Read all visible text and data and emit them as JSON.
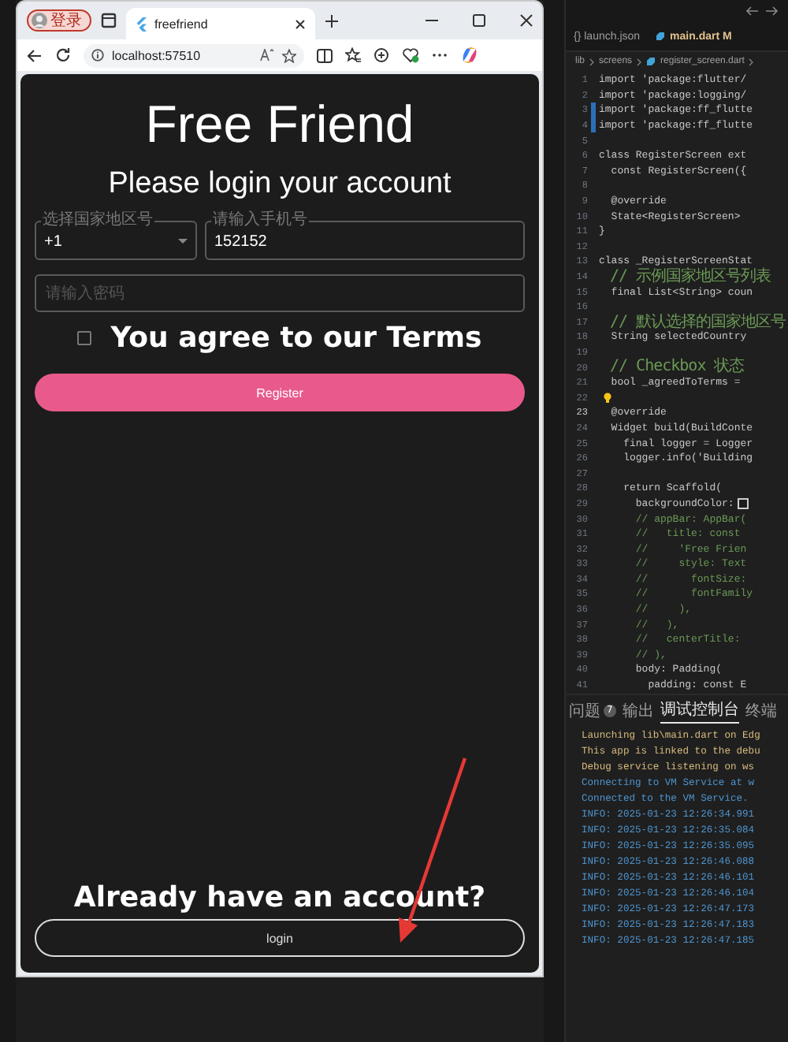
{
  "browser": {
    "profile_button": "登录",
    "tab": {
      "title": "freefriend"
    },
    "address": "localhost:57510"
  },
  "page": {
    "title": "Free Friend",
    "subtitle": "Please login your account",
    "country_field": {
      "label": "选择国家地区号",
      "value": "+1"
    },
    "phone_field": {
      "label": "请输入手机号",
      "value": "152152"
    },
    "password_field": {
      "placeholder": "请输入密码"
    },
    "terms": {
      "label": "You agree to our Terms",
      "checked": false
    },
    "register_button": "Register",
    "login_prompt": "Already have an account?",
    "login_button": "login"
  },
  "editor": {
    "tabs": [
      {
        "label": "{} launch.json",
        "modified": false
      },
      {
        "label": "main.dart",
        "badge": "M",
        "modified": true
      }
    ],
    "breadcrumb": [
      "lib",
      "screens",
      "register_screen.dart"
    ],
    "lines": [
      {
        "number": "1",
        "code": "import 'package:flutter/",
        "kind": "code",
        "current": false,
        "lightbulb": false,
        "changed": false
      },
      {
        "number": "2",
        "code": "import 'package:logging/",
        "kind": "code",
        "current": false,
        "lightbulb": false,
        "changed": false
      },
      {
        "number": "3",
        "code": "import 'package:ff_flutte",
        "kind": "code",
        "current": false,
        "lightbulb": false,
        "changed": true
      },
      {
        "number": "4",
        "code": "import 'package:ff_flutte",
        "kind": "code",
        "current": false,
        "lightbulb": false,
        "changed": true
      },
      {
        "number": "5",
        "current": false,
        "lightbulb": false,
        "changed": false
      },
      {
        "number": "6",
        "code": "class RegisterScreen ext",
        "kind": "code",
        "current": false,
        "lightbulb": false,
        "changed": false
      },
      {
        "number": "7",
        "code": "  const RegisterScreen({",
        "kind": "code",
        "current": false,
        "lightbulb": false,
        "changed": false
      },
      {
        "number": "8",
        "current": false,
        "lightbulb": false,
        "changed": false
      },
      {
        "number": "9",
        "code": "  @override",
        "kind": "code",
        "current": false,
        "lightbulb": false,
        "changed": false
      },
      {
        "number": "10",
        "code": "  State<RegisterScreen>",
        "kind": "code",
        "current": false,
        "lightbulb": false,
        "changed": false
      },
      {
        "number": "11",
        "code": "}",
        "kind": "code",
        "current": false,
        "lightbulb": false,
        "changed": false
      },
      {
        "number": "12",
        "current": false,
        "lightbulb": false,
        "changed": false
      },
      {
        "number": "13",
        "code": "class _RegisterScreenStat",
        "kind": "code",
        "current": false,
        "lightbulb": false,
        "changed": false
      },
      {
        "number": "14",
        "code": "// 示例国家地区号列表",
        "kind": "note",
        "current": false,
        "lightbulb": false,
        "changed": false
      },
      {
        "number": "15",
        "code": "  final List<String> coun",
        "kind": "code",
        "current": false,
        "lightbulb": false,
        "changed": false
      },
      {
        "number": "16",
        "current": false,
        "lightbulb": false,
        "changed": false
      },
      {
        "number": "17",
        "code": "// 默认选择的国家地区号",
        "kind": "note",
        "current": false,
        "lightbulb": false,
        "changed": false
      },
      {
        "number": "18",
        "code": "  String selectedCountry",
        "kind": "code",
        "current": false,
        "lightbulb": false,
        "changed": false
      },
      {
        "number": "19",
        "current": false,
        "lightbulb": false,
        "changed": false
      },
      {
        "number": "20",
        "code": "// Checkbox 状态",
        "kind": "note",
        "current": false,
        "lightbulb": false,
        "changed": false
      },
      {
        "number": "21",
        "code": "  bool _agreedToTerms =",
        "kind": "code",
        "current": false,
        "lightbulb": false,
        "changed": false
      },
      {
        "number": "22",
        "current": false,
        "lightbulb": true,
        "changed": false
      },
      {
        "number": "23",
        "code": "  @override",
        "kind": "code",
        "current": true,
        "lightbulb": false,
        "changed": false
      },
      {
        "number": "24",
        "code": "  Widget build(BuildConte",
        "kind": "code",
        "current": false,
        "lightbulb": false,
        "changed": false
      },
      {
        "number": "25",
        "code": "    final logger = Logger",
        "kind": "code",
        "current": false,
        "lightbulb": false,
        "changed": false
      },
      {
        "number": "26",
        "code": "    logger.info('Building",
        "kind": "code",
        "current": false,
        "lightbulb": false,
        "changed": false
      },
      {
        "number": "27",
        "current": false,
        "lightbulb": false,
        "changed": false
      },
      {
        "number": "28",
        "code": "    return Scaffold(",
        "kind": "code",
        "current": false,
        "lightbulb": false,
        "changed": false
      },
      {
        "number": "29",
        "code": "      backgroundColor:",
        "kind": "swatch",
        "current": false,
        "lightbulb": false,
        "changed": false
      },
      {
        "number": "30",
        "code": "      // appBar: AppBar(",
        "kind": "comment",
        "current": false,
        "lightbulb": false,
        "changed": false
      },
      {
        "number": "31",
        "code": "      //   title: const",
        "kind": "comment",
        "current": false,
        "lightbulb": false,
        "changed": false
      },
      {
        "number": "32",
        "code": "      //     'Free Frien",
        "kind": "comment",
        "current": false,
        "lightbulb": false,
        "changed": false
      },
      {
        "number": "33",
        "code": "      //     style: Text",
        "kind": "comment",
        "current": false,
        "lightbulb": false,
        "changed": false
      },
      {
        "number": "34",
        "code": "      //       fontSize:",
        "kind": "comment",
        "current": false,
        "lightbulb": false,
        "changed": false
      },
      {
        "number": "35",
        "code": "      //       fontFamily",
        "kind": "comment",
        "current": false,
        "lightbulb": false,
        "changed": false
      },
      {
        "number": "36",
        "code": "      //     ),",
        "kind": "comment",
        "current": false,
        "lightbulb": false,
        "changed": false
      },
      {
        "number": "37",
        "code": "      //   ),",
        "kind": "comment",
        "current": false,
        "lightbulb": false,
        "changed": false
      },
      {
        "number": "38",
        "code": "      //   centerTitle:",
        "kind": "comment",
        "current": false,
        "lightbulb": false,
        "changed": false
      },
      {
        "number": "39",
        "code": "      // ),",
        "kind": "comment",
        "current": false,
        "lightbulb": false,
        "changed": false
      },
      {
        "number": "40",
        "code": "      body: Padding(",
        "kind": "code",
        "current": false,
        "lightbulb": false,
        "changed": false
      },
      {
        "number": "41",
        "code": "        padding: const E",
        "kind": "code",
        "current": false,
        "lightbulb": false,
        "changed": false
      }
    ]
  },
  "panel": {
    "tabs": [
      {
        "label": "问题",
        "badge": "7",
        "selected": false
      },
      {
        "label": "输出",
        "selected": false
      },
      {
        "label": "调试控制台",
        "selected": true
      },
      {
        "label": "终端",
        "selected": false
      }
    ],
    "log": [
      {
        "text": "Launching lib\\main.dart on Edg",
        "kind": "warn"
      },
      {
        "text": "This app is linked to the debu",
        "kind": "warn"
      },
      {
        "text": "Debug service listening on ws",
        "kind": "warn"
      },
      {
        "text": "Connecting to VM Service at w",
        "kind": "info"
      },
      {
        "text": "Connected to the VM Service.",
        "kind": "info"
      },
      {
        "text": "INFO: 2025-01-23 12:26:34.991",
        "kind": "info"
      },
      {
        "text": "INFO: 2025-01-23 12:26:35.084",
        "kind": "info"
      },
      {
        "text": "INFO: 2025-01-23 12:26:35.095",
        "kind": "info"
      },
      {
        "text": "INFO: 2025-01-23 12:26:46.088",
        "kind": "info"
      },
      {
        "text": "INFO: 2025-01-23 12:26:46.101",
        "kind": "info"
      },
      {
        "text": "INFO: 2025-01-23 12:26:46.104",
        "kind": "info"
      },
      {
        "text": "INFO: 2025-01-23 12:26:47.173",
        "kind": "info"
      },
      {
        "text": "INFO: 2025-01-23 12:26:47.183",
        "kind": "info"
      },
      {
        "text": "INFO: 2025-01-23 12:26:47.185",
        "kind": "info"
      }
    ]
  }
}
